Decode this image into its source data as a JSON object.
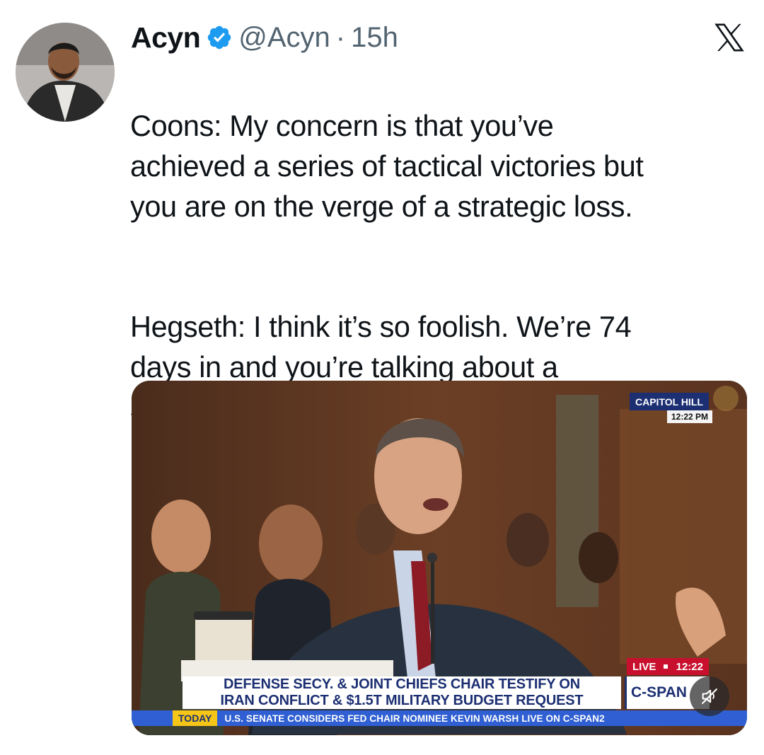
{
  "author": {
    "name": "Acyn",
    "handle": "@Acyn",
    "separator": "·",
    "time": "15h"
  },
  "tweet": {
    "paragraph1": "Coons: My concern is that you’ve\nachieved a series of tactical victories but\nyou are on the verge of a strategic loss.",
    "paragraph2": "Hegseth: I think it’s so foolish. We’re 74\ndays in and you’re talking about a\nstrategic loss?!?!?"
  },
  "video": {
    "location": "CAPITOL HILL",
    "clock": "12:22 PM",
    "live_label": "LIVE",
    "live_time": "12:22",
    "chyron_line1": "DEFENSE SECY. & JOINT CHIEFS CHAIR TESTIFY ON",
    "chyron_line2": "IRAN CONFLICT & $1.5T MILITARY BUDGET REQUEST",
    "network": "C-SPAN",
    "ticker_label": "TODAY",
    "ticker_text": "U.S. SENATE CONSIDERS FED CHAIR NOMINEE KEVIN WARSH  LIVE ON C-SPAN2"
  },
  "icons": {
    "verified": "verified-badge-icon",
    "platform": "x-logo-icon",
    "mute": "muted-speaker-icon"
  },
  "colors": {
    "verified_blue": "#1d9bf0",
    "handle_gray": "#536471",
    "cspan_navy": "#1c2f72",
    "live_red": "#c8102e",
    "ticker_blue": "#2f5fd2",
    "ticker_label_yellow": "#f5c518"
  }
}
